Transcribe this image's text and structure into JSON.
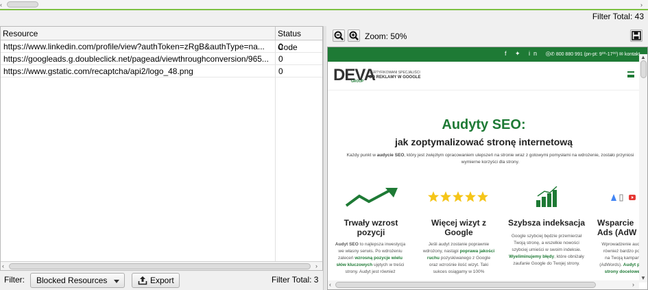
{
  "filter_total_top": "Filter Total:  43",
  "table": {
    "headers": [
      "Resource",
      "Status Code"
    ],
    "rows": [
      {
        "resource": "https://www.linkedin.com/profile/view?authToken=zRgB&authType=na...",
        "status": "0"
      },
      {
        "resource": "https://googleads.g.doubleclick.net/pagead/viewthroughconversion/965...",
        "status": "0"
      },
      {
        "resource": "https://www.gstatic.com/recaptcha/api2/logo_48.png",
        "status": "0"
      }
    ]
  },
  "filter_bar": {
    "label": "Filter:",
    "selected": "Blocked Resources",
    "export_label": "Export",
    "total": "Filter Total: 3"
  },
  "preview_toolbar": {
    "zoom_label": "Zoom: 50%"
  },
  "site": {
    "phone": "800 880 991 (pn-pt: 9⁰⁰-17⁰⁰)",
    "contact": "kontakt",
    "logo": "DEVA",
    "logo_group": "GROUP",
    "tagline1": "CERTYFIKOWANI SPECJALIŚCI",
    "tagline2": "OD REKLAMY W GOOGLE",
    "hero_title": "Audyty SEO:",
    "hero_subtitle": "jak zoptymalizować stronę internetową",
    "hero_text_a": "Każdy punkt w ",
    "hero_text_b": "audycie SEO",
    "hero_text_c": ", który jest zwięzłym opracowaniem ulepszeń na stronie wraz z gotowymi pomysłami na wdrożenie, zostało przyniosi wymierne korzyści dla strony.",
    "cards": [
      {
        "title": "Trwały wzrost pozycji",
        "t1": "Audyt SEO",
        "t2": " to najlepsza inwestycja we własny serwis. Po wdrożeniu zaleceń ",
        "t3": "wzrosną pozycje wielu słów kluczowych",
        "t4": " ujętych w treści strony. Audyt jest również"
      },
      {
        "title": "Więcej wizyt z Google",
        "t1": "",
        "t2": "Jeśli audyt zostanie poprawnie wdrożony, nastąpi ",
        "t3": "poprawa jakości ruchu",
        "t4": " pozyskiwanego z Google oraz wzrośnie ilość wizyt. Taki sukces osiągamy w 100%"
      },
      {
        "title": "Szybsza indeksacja",
        "t1": "",
        "t2": "Google szybciej będzie przemierzał Twoją stronę, a wszelkie nowości szybciej umieści w swoim indeksie. ",
        "t3": "Wyeliminujemy błędy",
        "t4": ", które obniżały zaufanie Google do Twojej strony."
      },
      {
        "title": "Wsparcie Ads (AdW",
        "t1": "",
        "t2": "Wprowadzenie aud również bardzo po na Twoją kampan (AdWords). ",
        "t3": "Audyt p strony docelowe",
        "t4": ""
      }
    ]
  }
}
